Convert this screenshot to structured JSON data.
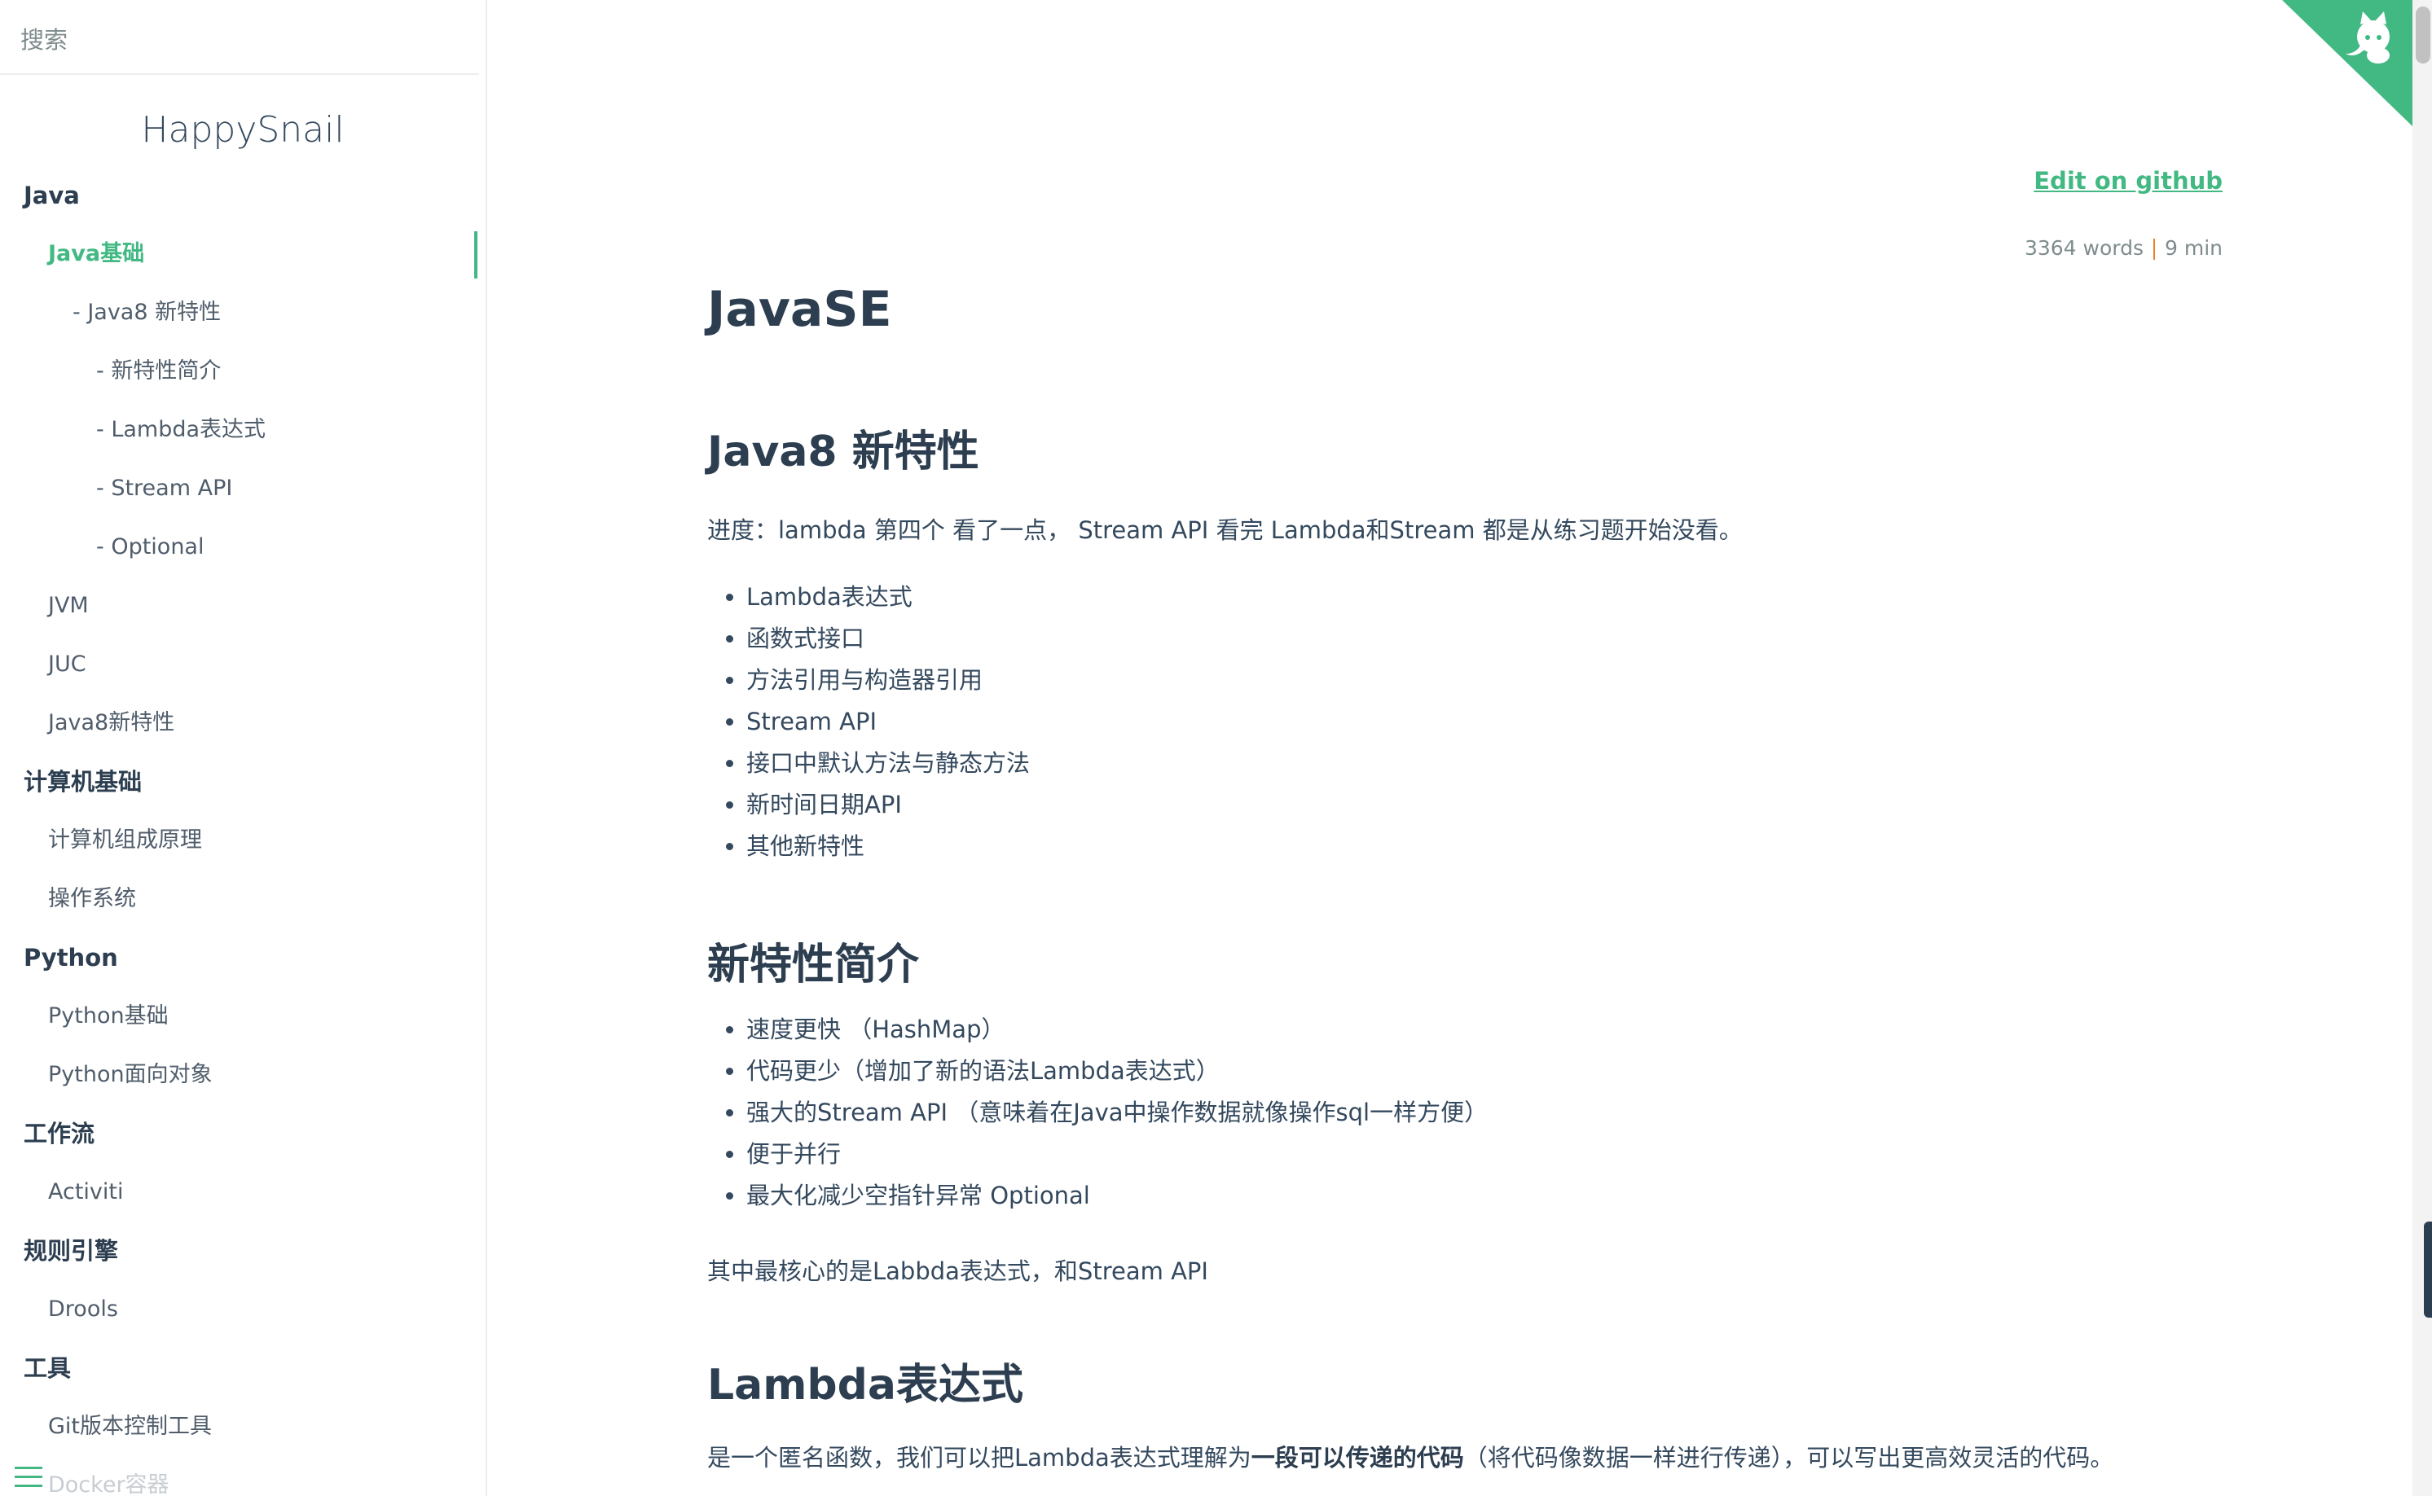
{
  "sidebar": {
    "search_placeholder": "搜索",
    "app_name": "HappySnail",
    "items": [
      {
        "label": "Java",
        "level": "section"
      },
      {
        "label": "Java基础",
        "level": "level1",
        "active": true
      },
      {
        "label": "- Java8 新特性",
        "level": "level2"
      },
      {
        "label": "- 新特性简介",
        "level": "level3"
      },
      {
        "label": "- Lambda表达式",
        "level": "level3"
      },
      {
        "label": "- Stream API",
        "level": "level3"
      },
      {
        "label": "- Optional",
        "level": "level3"
      },
      {
        "label": "JVM",
        "level": "level1"
      },
      {
        "label": "JUC",
        "level": "level1"
      },
      {
        "label": "Java8新特性",
        "level": "level1"
      },
      {
        "label": "计算机基础",
        "level": "section"
      },
      {
        "label": "计算机组成原理",
        "level": "level1"
      },
      {
        "label": "操作系统",
        "level": "level1"
      },
      {
        "label": "Python",
        "level": "section"
      },
      {
        "label": "Python基础",
        "level": "level1"
      },
      {
        "label": "Python面向对象",
        "level": "level1"
      },
      {
        "label": "工作流",
        "level": "section"
      },
      {
        "label": "Activiti",
        "level": "level1"
      },
      {
        "label": "规则引擎",
        "level": "section"
      },
      {
        "label": "Drools",
        "level": "level1"
      },
      {
        "label": "工具",
        "level": "section"
      },
      {
        "label": "Git版本控制工具",
        "level": "level1"
      },
      {
        "label": "Docker容器",
        "level": "level1",
        "faded": true
      }
    ]
  },
  "article": {
    "edit_link": "Edit on github",
    "words": "3364 words",
    "read_time": "9 min",
    "title": "JavaSE",
    "s1_heading": "Java8 新特性",
    "s1_progress": "进度：lambda 第四个 看了一点， Stream API 看完 Lambda和Stream 都是从练习题开始没看。",
    "s1_list": [
      "Lambda表达式",
      "函数式接口",
      "方法引用与构造器引用",
      "Stream API",
      "接口中默认方法与静态方法",
      "新时间日期API",
      "其他新特性"
    ],
    "s2_heading": "新特性简介",
    "s2_list": [
      "速度更快 （HashMap）",
      "代码更少（增加了新的语法Lambda表达式）",
      "强大的Stream API （意味着在Java中操作数据就像操作sql一样方便）",
      "便于并行",
      "最大化减少空指针异常 Optional"
    ],
    "s2_summary": "其中最核心的是Labbda表达式，和Stream API",
    "s3_heading": "Lambda表达式",
    "s3_text_before": "是一个匿名函数，我们可以把Lambda表达式理解为",
    "s3_text_bold": "一段可以传递的代码",
    "s3_text_after": "（将代码像数据一样进行传递），可以写出更高效灵活的代码。"
  },
  "colors": {
    "accent": "#42b983",
    "text": "#34495e",
    "heading": "#2c3e50"
  },
  "icons": {
    "github_corner": "github-octocat-icon",
    "menu": "hamburger-menu-icon"
  }
}
